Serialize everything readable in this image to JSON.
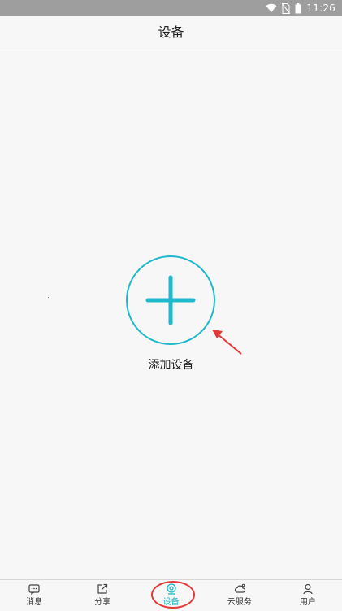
{
  "status_bar": {
    "time": "11:26",
    "icons": [
      "wifi-icon",
      "no-sim-icon",
      "battery-icon"
    ]
  },
  "header": {
    "title": "设备"
  },
  "main": {
    "add_device": {
      "label": "添加设备",
      "icon": "plus-icon"
    }
  },
  "bottom_nav": {
    "items": [
      {
        "label": "消息",
        "icon": "message-icon",
        "active": false
      },
      {
        "label": "分享",
        "icon": "share-icon",
        "active": false
      },
      {
        "label": "设备",
        "icon": "device-camera-icon",
        "active": true
      },
      {
        "label": "云服务",
        "icon": "cloud-icon",
        "active": false
      },
      {
        "label": "用户",
        "icon": "user-icon",
        "active": false
      }
    ]
  },
  "colors": {
    "accent": "#1fb8cc",
    "annotation": "#e53935",
    "status_bar_bg": "#9e9e9e",
    "background": "#f7f7f7"
  }
}
